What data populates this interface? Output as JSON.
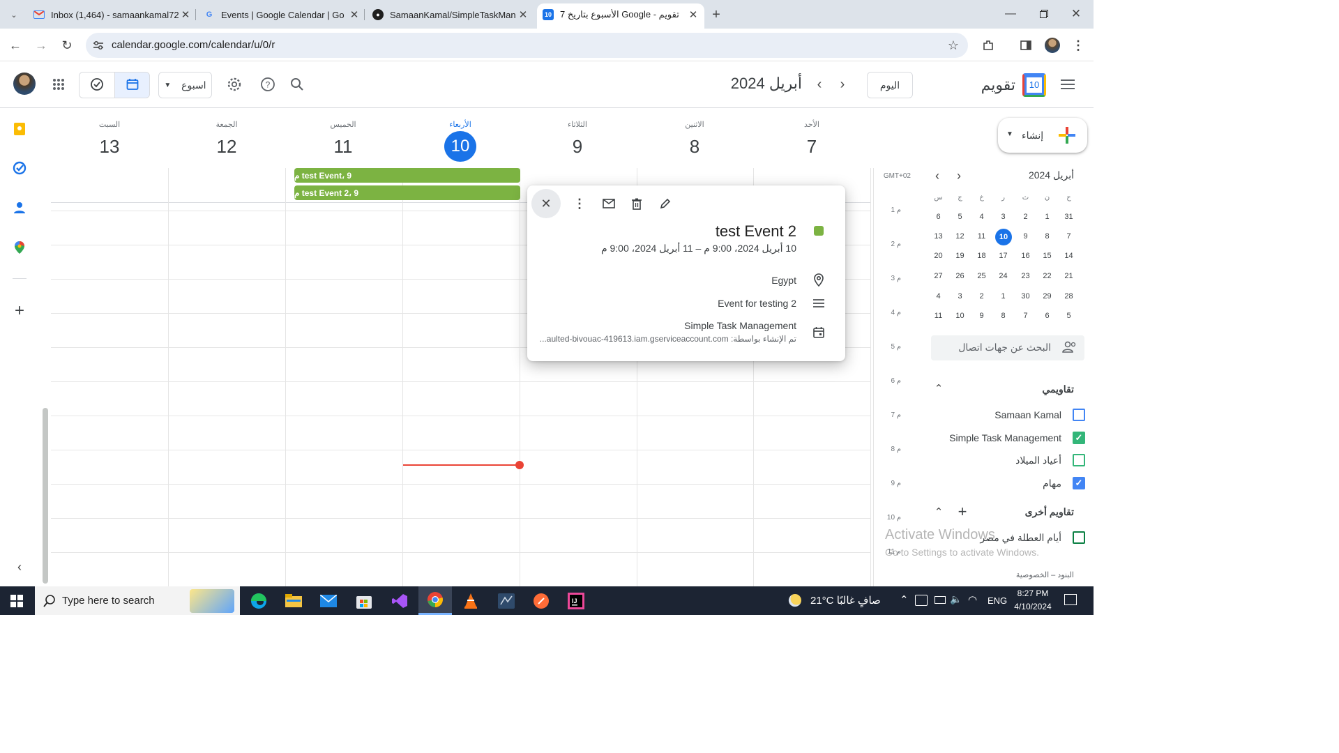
{
  "browser": {
    "tabs": [
      {
        "title": "Inbox (1,464) - samaankamal72",
        "icon": "gmail-icon"
      },
      {
        "title": "Events | Google Calendar | Go",
        "icon": "google-icon"
      },
      {
        "title": "SamaanKamal/SimpleTaskMana",
        "icon": "github-icon"
      },
      {
        "title": "تقويم - Google الأسبوع بتاريخ 7",
        "icon": "calendar-icon",
        "active": true
      }
    ],
    "url": "calendar.google.com/calendar/u/0/r"
  },
  "header": {
    "app_name": "تقويم",
    "logo_day": "10",
    "today_button": "اليوم",
    "month_label": "أبريل 2024",
    "view_select": "اسبوع"
  },
  "week": {
    "days": [
      {
        "name": "الأحد",
        "num": "7"
      },
      {
        "name": "الاثنين",
        "num": "8"
      },
      {
        "name": "الثلاثاء",
        "num": "9"
      },
      {
        "name": "الأربعاء",
        "num": "10",
        "today": true
      },
      {
        "name": "الخميس",
        "num": "11"
      },
      {
        "name": "الجمعة",
        "num": "12"
      },
      {
        "name": "السبت",
        "num": "13"
      }
    ],
    "timezone": "GMT+02",
    "hours": [
      "1 م",
      "2 م",
      "3 م",
      "4 م",
      "5 م",
      "6 م",
      "7 م",
      "8 م",
      "9 م",
      "10 م",
      "11 م"
    ],
    "allday_events": [
      "test Event، 9 م",
      "test Event 2، 9 م"
    ]
  },
  "popup": {
    "title": "test Event 2",
    "datetime": "10 أبريل 2024، 9:00 م – 11 أبريل 2024، 9:00 م",
    "location": "Egypt",
    "description": "Event for testing 2",
    "calendar": "Simple Task Management",
    "creator": "تم الإنشاء بواسطة: aulted-bivouac-419613.iam.gserviceaccount.com...",
    "color": "#7cb342"
  },
  "sidebar": {
    "create_label": "إنشاء",
    "mini_month": "أبريل 2024",
    "weekday_initials": [
      "ح",
      "ن",
      "ث",
      "ر",
      "خ",
      "ج",
      "س"
    ],
    "mini_weeks": [
      [
        "31",
        "1",
        "2",
        "3",
        "4",
        "5",
        "6"
      ],
      [
        "7",
        "8",
        "9",
        "10",
        "11",
        "12",
        "13"
      ],
      [
        "14",
        "15",
        "16",
        "17",
        "18",
        "19",
        "20"
      ],
      [
        "21",
        "22",
        "23",
        "24",
        "25",
        "26",
        "27"
      ],
      [
        "28",
        "29",
        "30",
        "1",
        "2",
        "3",
        "4"
      ],
      [
        "5",
        "6",
        "7",
        "8",
        "9",
        "10",
        "11"
      ]
    ],
    "search_people": "البحث عن جهات اتصال",
    "my_calendars_title": "تقاويمي",
    "my_calendars": [
      {
        "name": "Samaan Kamal",
        "checked": false,
        "color": "#4285f4"
      },
      {
        "name": "Simple Task Management",
        "checked": true,
        "color": "#33b679"
      },
      {
        "name": "أعياد الميلاد",
        "checked": false,
        "color": "#33b679"
      },
      {
        "name": "مهام",
        "checked": true,
        "color": "#4285f4"
      }
    ],
    "other_calendars_title": "تقاويم أخرى",
    "other_calendars": [
      {
        "name": "أيام العطلة في مصر",
        "checked": false,
        "color": "#0b8043"
      }
    ],
    "footer": "البنود – الخصوصية"
  },
  "watermark": {
    "line1": "Activate Windows",
    "line2": "Go to Settings to activate Windows."
  },
  "taskbar": {
    "search_placeholder": "Type here to search",
    "weather": "21°C  صافٍ غالبًا",
    "lang": "ENG",
    "time": "8:27 PM",
    "date": "4/10/2024"
  }
}
